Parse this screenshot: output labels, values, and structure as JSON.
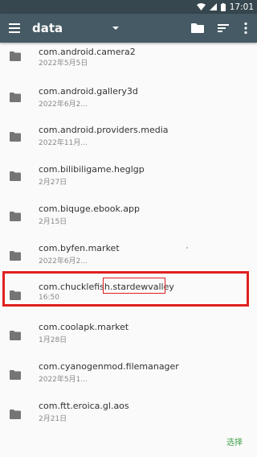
{
  "status_bar": {
    "time": "17:01",
    "icons": [
      "wifi-icon",
      "signal-icon",
      "battery-icon"
    ]
  },
  "app_bar": {
    "title": "data",
    "actions": [
      "folder-icon",
      "sort-icon",
      "more-vert-icon"
    ]
  },
  "folders": [
    {
      "name": "com.android.camera2",
      "date": "2022年5月5日"
    },
    {
      "name": "com.android.gallery3d",
      "date": "2022年6月2..."
    },
    {
      "name": "com.android.providers.media",
      "date": "2022年11月..."
    },
    {
      "name": "com.bilibiligame.heglgp",
      "date": "2月27日"
    },
    {
      "name": "com.biquge.ebook.app",
      "date": "2月15日"
    },
    {
      "name": "com.byfen.market",
      "date": "2022年6月2..."
    },
    {
      "name": "com.chucklefish.stardewvalley",
      "date": "16:50"
    },
    {
      "name": "com.coolapk.market",
      "date": "1月28日"
    },
    {
      "name": "com.cyanogenmod.filemanager",
      "date": "2022年5月1..."
    },
    {
      "name": "com.ftt.eroica.gl.aos",
      "date": "2月21日"
    }
  ],
  "bottom_bar": {
    "select_label": "选择"
  },
  "colors": {
    "status_bar_bg": "#37474f",
    "app_bar_bg": "#455a64",
    "highlight": "#e02020",
    "accent": "#3ea14a"
  }
}
